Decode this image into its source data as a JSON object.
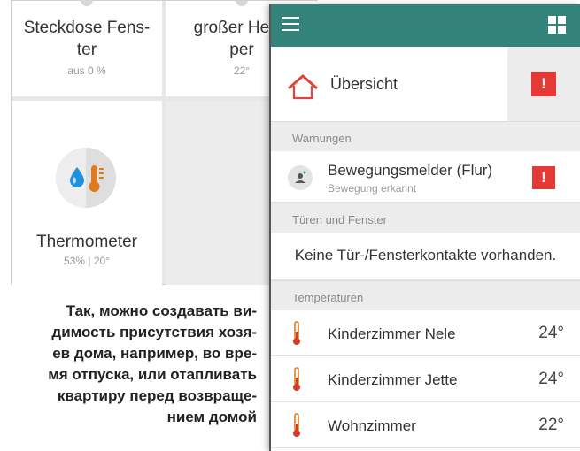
{
  "tiles": {
    "steckdose": {
      "name_line1": "Steckdose Fens-",
      "name_line2": "ter",
      "status": "aus 0 %"
    },
    "heizkoerper": {
      "name_line1": "großer Heizk",
      "name_line2": "per",
      "status": "22°"
    },
    "thermometer": {
      "name": "Thermometer",
      "status": "53% | 20°"
    }
  },
  "caption": {
    "line1": "Так, можно создавать ви-",
    "line2": "димость присутствия хозя-",
    "line3": "ев дома, например, во вре-",
    "line4": "мя отпуска, или отапливать",
    "line5": "квартиру перед возвраще-",
    "line6": "нием домой"
  },
  "app": {
    "accent_color": "#34837a",
    "alert_color": "#e53935",
    "menu_icon": "hamburger-menu-icon",
    "grid_icon": "grid-view-icon",
    "overview": {
      "label": "Übersicht",
      "icon": "home-icon",
      "badge": "!"
    },
    "sections": {
      "warnings": "Warnungen",
      "doors": "Türen und Fenster",
      "temperatures": "Temperaturen"
    },
    "warning": {
      "title": "Bewegungsmelder (Flur)",
      "subtitle": "Bewegung erkannt",
      "badge": "!",
      "icon": "motion-sensor-icon"
    },
    "doors_empty": "Keine Tür-/Fensterkontakte vorhanden.",
    "temperatures": [
      {
        "name": "Kinderzimmer Nele",
        "value": "24°"
      },
      {
        "name": "Kinderzimmer Jette",
        "value": "24°"
      },
      {
        "name": "Wohnzimmer",
        "value": "22°"
      }
    ]
  }
}
